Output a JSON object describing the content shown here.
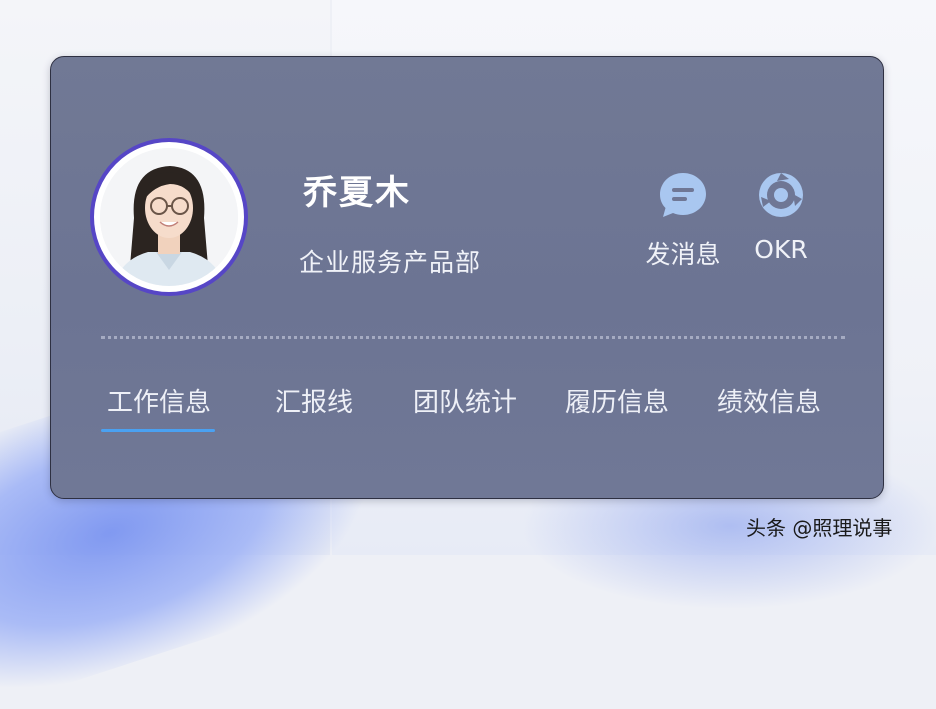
{
  "profile": {
    "name": "乔夏木",
    "department": "企业服务产品部"
  },
  "actions": {
    "message_label": "发消息",
    "okr_label": "OKR",
    "message_icon": "chat-bubble-icon",
    "okr_icon": "okr-target-icon"
  },
  "tabs": [
    {
      "label": "工作信息",
      "active": true
    },
    {
      "label": "汇报线",
      "active": false
    },
    {
      "label": "团队统计",
      "active": false
    },
    {
      "label": "履历信息",
      "active": false
    },
    {
      "label": "绩效信息",
      "active": false
    }
  ],
  "watermark": "头条 @照理说事",
  "colors": {
    "card_bg": "#6f7795",
    "avatar_ring": "#5646c6",
    "tab_underline": "#4aa1f2",
    "icon_fill": "#a9c7f0"
  }
}
